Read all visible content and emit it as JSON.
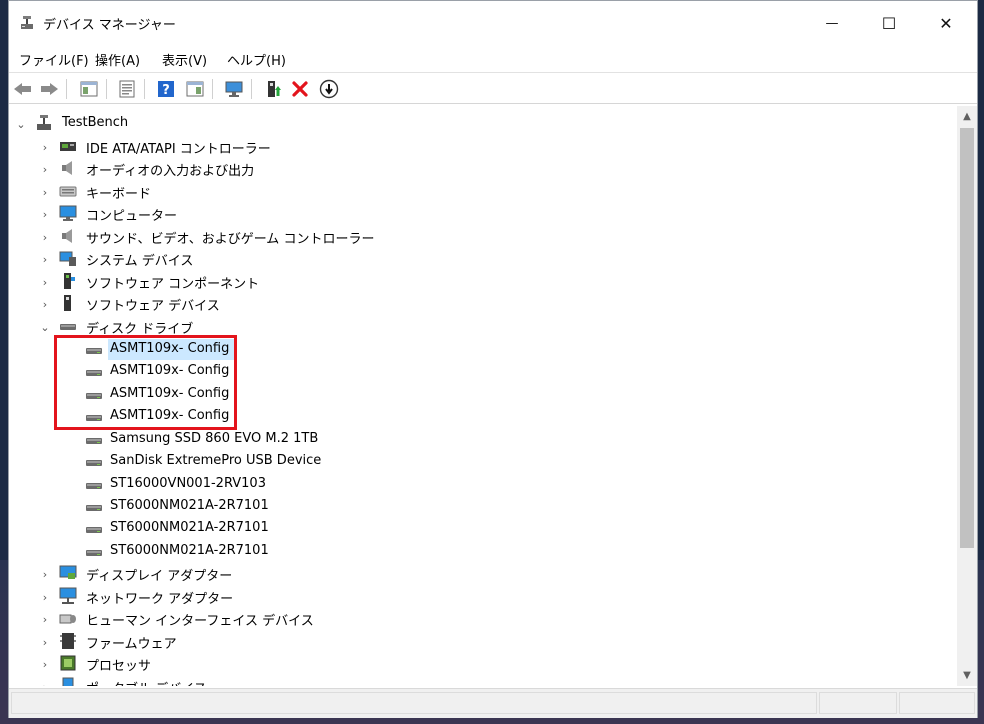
{
  "window": {
    "title": "デバイス マネージャー",
    "controls": {
      "minimize": "—",
      "maximize": "☐",
      "close": "✕"
    }
  },
  "menu": [
    {
      "label": "ファイル(F)"
    },
    {
      "label": "操作(A)"
    },
    {
      "label": "表示(V)"
    },
    {
      "label": "ヘルプ(H)"
    }
  ],
  "toolbar": {
    "buttons": [
      "back-icon",
      "forward-icon",
      "show-hide-tree-icon",
      "properties-icon",
      "help-icon",
      "action-pane-icon",
      "scan-hardware-icon",
      "update-driver-icon",
      "uninstall-icon",
      "disable-device-icon"
    ]
  },
  "tree": {
    "root": "TestBench",
    "categories_before": [
      {
        "label": "IDE ATA/ATAPI コントローラー",
        "icon": "ide-controller-icon"
      },
      {
        "label": "オーディオの入力および出力",
        "icon": "speaker-icon"
      },
      {
        "label": "キーボード",
        "icon": "keyboard-icon"
      },
      {
        "label": "コンピューター",
        "icon": "computer-icon"
      },
      {
        "label": "サウンド、ビデオ、およびゲーム コントローラー",
        "icon": "speaker-icon"
      },
      {
        "label": "システム デバイス",
        "icon": "system-device-icon"
      },
      {
        "label": "ソフトウェア コンポーネント",
        "icon": "software-component-icon"
      },
      {
        "label": "ソフトウェア デバイス",
        "icon": "software-device-icon"
      }
    ],
    "expanded_category": {
      "label": "ディスク ドライブ",
      "icon": "disk-drive-icon"
    },
    "disk_drives": [
      "ASMT109x- Config",
      "ASMT109x- Config",
      "ASMT109x- Config",
      "ASMT109x- Config",
      "Samsung SSD 860 EVO M.2 1TB",
      "SanDisk ExtremePro USB Device",
      "ST16000VN001-2RV103",
      "ST6000NM021A-2R7101",
      "ST6000NM021A-2R7101",
      "ST6000NM021A-2R7101"
    ],
    "categories_after": [
      {
        "label": "ディスプレイ アダプター",
        "icon": "display-adapter-icon"
      },
      {
        "label": "ネットワーク アダプター",
        "icon": "network-adapter-icon"
      },
      {
        "label": "ヒューマン インターフェイス デバイス",
        "icon": "hid-icon"
      },
      {
        "label": "ファームウェア",
        "icon": "firmware-icon"
      },
      {
        "label": "プロセッサ",
        "icon": "processor-icon"
      },
      {
        "label": "ポータブル デバイス",
        "icon": "portable-device-icon"
      }
    ]
  },
  "colors": {
    "selection": "#cce8ff",
    "highlight_box": "#e3141c",
    "accent_blue": "#1e6fc8"
  }
}
